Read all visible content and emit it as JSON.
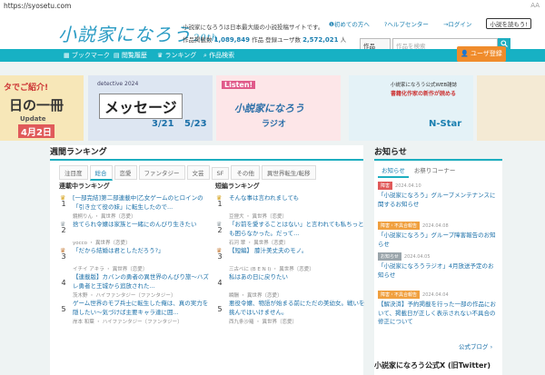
{
  "browser": {
    "url": "https://syosetu.com",
    "aa": "AA"
  },
  "header": {
    "logo": "小説家になろう",
    "logo_sub": "20th",
    "tagline": "小説家になろうは日本最大級の小説投稿サイトです。",
    "stats_works_label": "作品掲載数",
    "stats_works": "1,089,849",
    "stats_works_unit": "作品",
    "stats_users_label": "登録ユーザ数",
    "stats_users": "2,572,021",
    "stats_users_unit": "人",
    "link_beginner": "初めての方へ",
    "link_help": "ヘルプセンター",
    "link_login": "ログイン",
    "link_read": "小説を読もう!",
    "search_select": "作品",
    "search_placeholder": "作品を検索"
  },
  "nav": {
    "bookmark": "ブックマーク",
    "history": "閲覧履歴",
    "ranking": "ランキング",
    "search": "作品検索",
    "register": "ユーザ登録"
  },
  "banners": {
    "b1_line1": "タでご紹介!",
    "b1_line2": "日の一冊",
    "b1_line3": "Update",
    "b1_line4": "4月2日",
    "b2_line1": "メッセージ",
    "b2_line2": "3/21",
    "b2_line3": "5/23",
    "b2_line4": "detective 2024",
    "b3_line1": "Listen!",
    "b3_line2": "小説家になろう",
    "b3_line3": "ラジオ",
    "b4_line1": "小説家になろう公式WEB雑誌",
    "b4_line2": "書籍化作家の新作が読める",
    "b4_line3": "N-Star"
  },
  "ranking": {
    "heading": "週間ランキング",
    "tabs": [
      "注目度",
      "総合",
      "恋愛",
      "ファンタジー",
      "文芸",
      "SF",
      "その他",
      "異世界転生/転移"
    ],
    "left_heading": "連載中ランキング",
    "right_heading": "短編ランキング",
    "left": [
      {
        "no": "1",
        "title": "[一部完結]第二部連載中|乙女ゲームのヒロインの「引き立て役の妹」に転生したので...",
        "meta": "鏡桐りん ・ 異世界〔恋愛〕"
      },
      {
        "no": "2",
        "title": "捨てられ令嬢は家族と一緒にのんびり生きたい",
        "meta": "yocco ・ 異世界〔恋愛〕"
      },
      {
        "no": "3",
        "title": "「だから結婚は君としただろう?」",
        "meta": "イチイ アキラ ・ 異世界〔恋愛〕"
      },
      {
        "no": "4",
        "title": "【連載版】カバンの勇者の異世界のんびり旅〜ハズレ勇者と王城から追放された...",
        "meta": "茨木野 ・ ハイファンタジー〔ファンタジー〕"
      },
      {
        "no": "5",
        "title": "ゲーム世界のモブ兵士に転生した俺は、真の実力を隠したい〜気づけば主要キャラ達に囲...",
        "meta": "岸本 和葉 ・ ハイファンタジー〔ファンタジー〕"
      }
    ],
    "right": [
      {
        "no": "1",
        "title": "そんな事は言われましても",
        "meta": "豆狸犬 ・ 異世界〔恋愛〕"
      },
      {
        "no": "2",
        "title": "「お前を愛することはない」と言われても私ちっとも困らなかった。だって...",
        "meta": "石河 翠 ・ 異世界〔恋愛〕"
      },
      {
        "no": "3",
        "title": "【短編】 膝汁美丈夫のモノ。",
        "meta": "三古ベに (B E N I) ・ 異世界〔恋愛〕"
      },
      {
        "no": "4",
        "title": "私はあの日に戻りたい",
        "meta": "瞬酬 ・ 異世界〔恋愛〕"
      },
      {
        "no": "5",
        "title": "悪役令嬢、物語が始まる前にただの美幼女。戦いを挑んではいけません。",
        "meta": "西九条沙羅 ・ 異世界〔恋愛〕"
      }
    ]
  },
  "news": {
    "heading": "お知らせ",
    "tab1": "お知らせ",
    "tab2": "お祭りコーナー",
    "items": [
      {
        "badge": "障害",
        "date": "2024.04.10",
        "text": "「小説家になろう」グループメンテナンスに関するお知らせ"
      },
      {
        "badge": "障害・不具合報告",
        "date": "2024.04.08",
        "text": "「小説家になろう」グループ障害報告のお知らせ"
      },
      {
        "badge": "お知らせ",
        "date": "2024.04.05",
        "text": "「小説家になろうラジオ」4月放送予定のお知らせ"
      },
      {
        "badge": "障害・不具合報告",
        "date": "2024.04.04",
        "text": "【解決済】予約掲載を行った一部の作品において、掲載日が正しく表示されない不具合の修正について"
      }
    ],
    "blog": "公式ブログ",
    "x_heading": "小説家になろう公式X (旧Twitter)"
  },
  "colors": {
    "accent": "#17b1c4",
    "link": "#1a6fa8",
    "register": "#f08c2c",
    "badge_red": "#e05a5a",
    "badge_orange": "#f0a040",
    "badge_gray": "#9aa5ab"
  }
}
